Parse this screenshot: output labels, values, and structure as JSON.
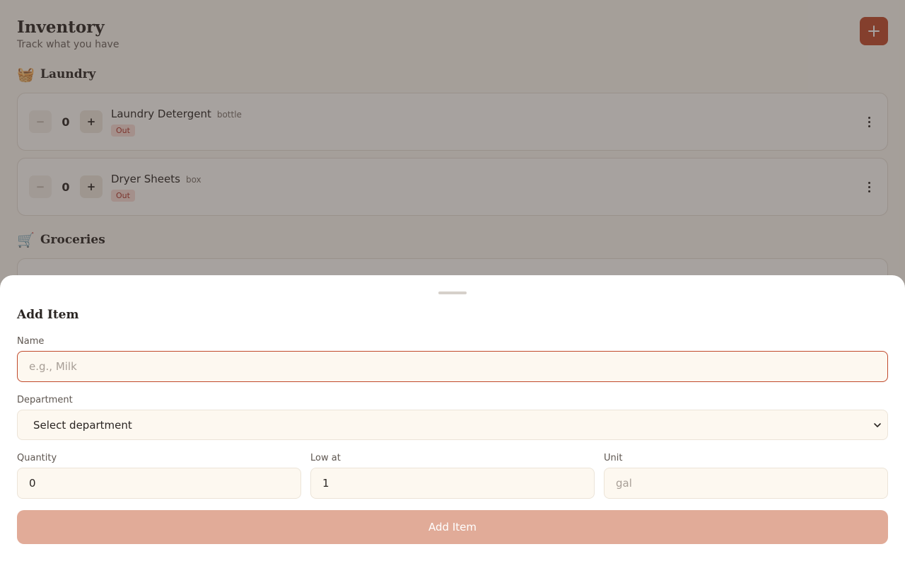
{
  "header": {
    "title": "Inventory",
    "subtitle": "Track what you have",
    "add_icon": "plus-icon"
  },
  "sections": [
    {
      "emoji": "🧺",
      "title": "Laundry",
      "items": [
        {
          "name": "Laundry Detergent",
          "unit": "bottle",
          "qty": "0",
          "status": "Out"
        },
        {
          "name": "Dryer Sheets",
          "unit": "box",
          "qty": "0",
          "status": "Out"
        }
      ]
    },
    {
      "emoji": "🛒",
      "title": "Groceries",
      "items": []
    }
  ],
  "stepper": {
    "minus": "−",
    "plus": "+"
  },
  "sheet": {
    "title": "Add Item",
    "name_label": "Name",
    "name_placeholder": "e.g., Milk",
    "department_label": "Department",
    "department_value": "Select department",
    "quantity_label": "Quantity",
    "quantity_value": "0",
    "low_label": "Low at",
    "low_value": "1",
    "unit_label": "Unit",
    "unit_placeholder": "gal",
    "submit_label": "Add Item"
  },
  "colors": {
    "accent": "#c0492b",
    "badge_bg": "#f9dcd5",
    "submit_disabled": "#e1ab98"
  }
}
